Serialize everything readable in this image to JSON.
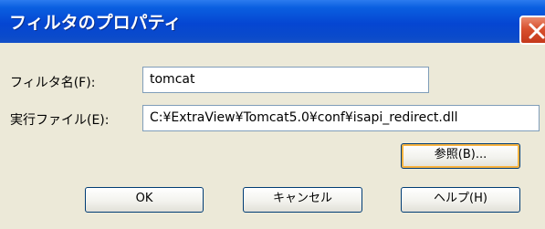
{
  "dialog": {
    "title": "フィルタのプロパティ",
    "filter_name_label": "フィルタ名(F):",
    "filter_name_value": "tomcat",
    "exec_file_label": "実行ファイル(E):",
    "exec_file_value": "C:¥ExtraView¥Tomcat5.0¥conf¥isapi_redirect.dll",
    "browse_label": "参照(B)...",
    "ok_label": "OK",
    "cancel_label": "キャンセル",
    "help_label": "ヘルプ(H)"
  },
  "icons": {
    "close": "close-icon"
  },
  "colors": {
    "titlebar": "#0546D2",
    "dialog_bg": "#ECE9D8",
    "close_button": "#D8512E",
    "field_border": "#7F9DB9"
  }
}
